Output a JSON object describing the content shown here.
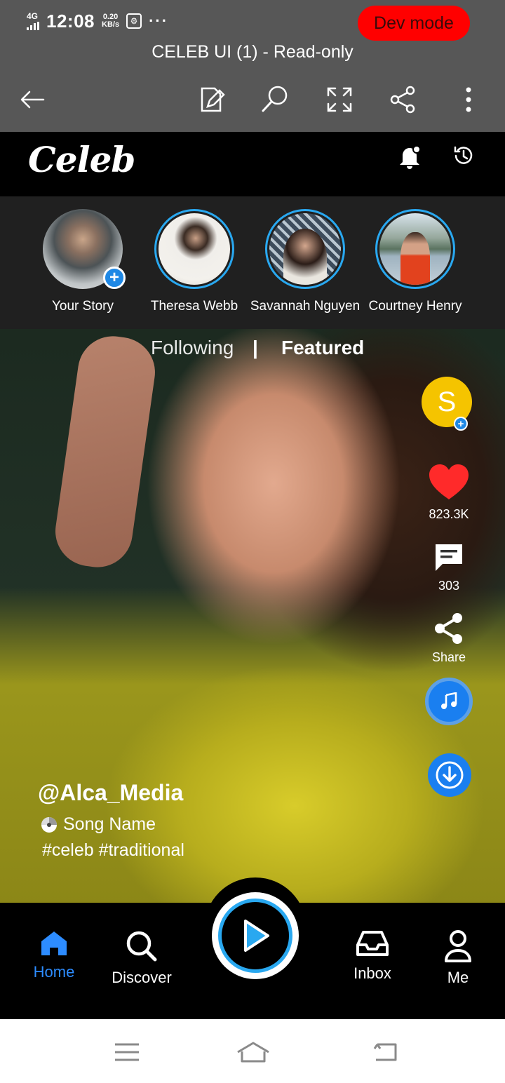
{
  "status_bar": {
    "network": "4G",
    "time": "12:08",
    "speed_value": "0.20",
    "speed_unit": "KB/s",
    "more": "···"
  },
  "dev_badge": "Dev mode",
  "viewer": {
    "title": "CELEB UI (1) - Read-only",
    "icons": [
      "back-arrow-icon",
      "edit-icon",
      "search-icon",
      "fullscreen-icon",
      "share-icon",
      "more-vert-icon"
    ]
  },
  "app": {
    "logo": "Celeb",
    "header_icons": [
      "bell-icon",
      "history-icon"
    ]
  },
  "stories": [
    {
      "name": "Your Story"
    },
    {
      "name": "Theresa Webb"
    },
    {
      "name": "Savannah Nguyen"
    },
    {
      "name": "Courtney Henry"
    }
  ],
  "feed_tabs": {
    "following": "Following",
    "separator": "|",
    "featured": "Featured"
  },
  "creator_initial": "S",
  "actions": {
    "likes": "823.3K",
    "comments": "303",
    "share": "Share"
  },
  "post": {
    "handle": "@Alca_Media",
    "song": "Song Name",
    "tags": "#celeb #traditional"
  },
  "bottom_nav": {
    "home": "Home",
    "discover": "Discover",
    "inbox": "Inbox",
    "me": "Me"
  },
  "colors": {
    "accent": "#2d8cff",
    "story_ring": "#29a8f0",
    "like": "#ff2a2a",
    "dev_badge": "#ff0000",
    "creator": "#f5c400"
  }
}
